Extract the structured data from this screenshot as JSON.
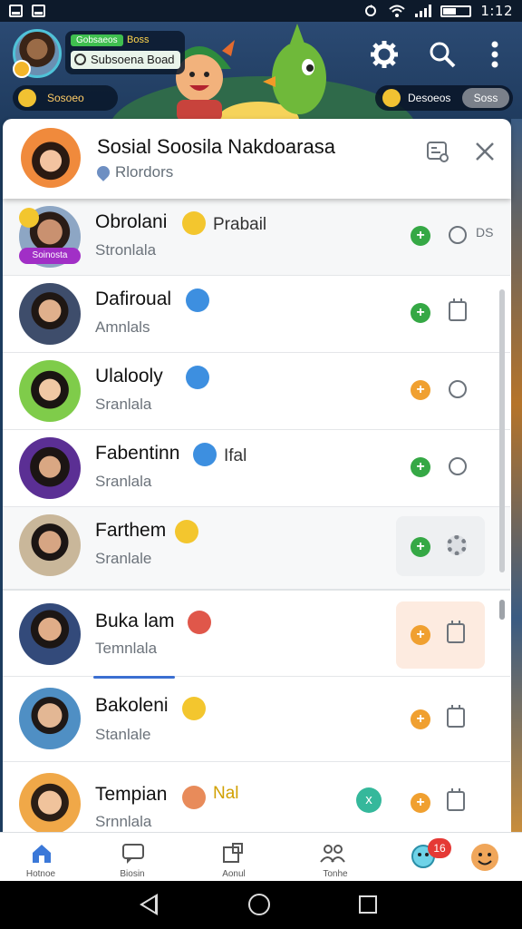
{
  "status_bar": {
    "time": "1:12"
  },
  "header": {
    "level_tag": "Gobsaeos",
    "level_sub": "Boss",
    "player_name": "Subsoena Boad",
    "left_pill_label": "Sosoeo",
    "right_pill_label": "Desoeos",
    "right_pill_button": "Soss"
  },
  "card": {
    "title": "Sosial Soosila Nakdoarasa",
    "subtitle": "Rlordors"
  },
  "chats": [
    {
      "name": "Obrolani",
      "subtitle": "Stronlala",
      "extra": "Prabail",
      "badge": "Soinosta",
      "action_color": "#35a845",
      "ring_text": "DS"
    },
    {
      "name": "Dafiroual",
      "subtitle": "Amnlals",
      "action_color": "#35a845"
    },
    {
      "name": "Ulalooly",
      "subtitle": "Sranlala",
      "action_color": "#f0a030"
    },
    {
      "name": "Fabentinn",
      "subtitle": "Sranlala",
      "extra": "Ifal",
      "action_color": "#35a845"
    },
    {
      "name": "Farthem",
      "subtitle": "Sranlale",
      "action_color": "#35a845"
    },
    {
      "name": "Buka lam",
      "subtitle": "Temnlala",
      "action_color": "#f0a030"
    },
    {
      "name": "Bakoleni",
      "subtitle": "Stanlale",
      "action_color": "#f0a030"
    },
    {
      "name": "Tempian",
      "subtitle": "Srnnlala",
      "extra": "Nal",
      "action_color": "#f0a030"
    }
  ],
  "tabs": [
    {
      "label": "Hotnoe",
      "icon": "home-icon"
    },
    {
      "label": "Biosin",
      "icon": "chat-bubble-icon"
    },
    {
      "label": "Aonul",
      "icon": "puzzle-icon"
    },
    {
      "label": "Tonhe",
      "icon": "people-icon"
    },
    {
      "label": "",
      "icon": "mascot-icon"
    },
    {
      "label": "",
      "icon": "profile-emoji-icon"
    }
  ],
  "notification_count": "16",
  "colors": {
    "accent_green": "#35a845",
    "accent_orange": "#f0a030",
    "badge_red": "#e53935"
  }
}
